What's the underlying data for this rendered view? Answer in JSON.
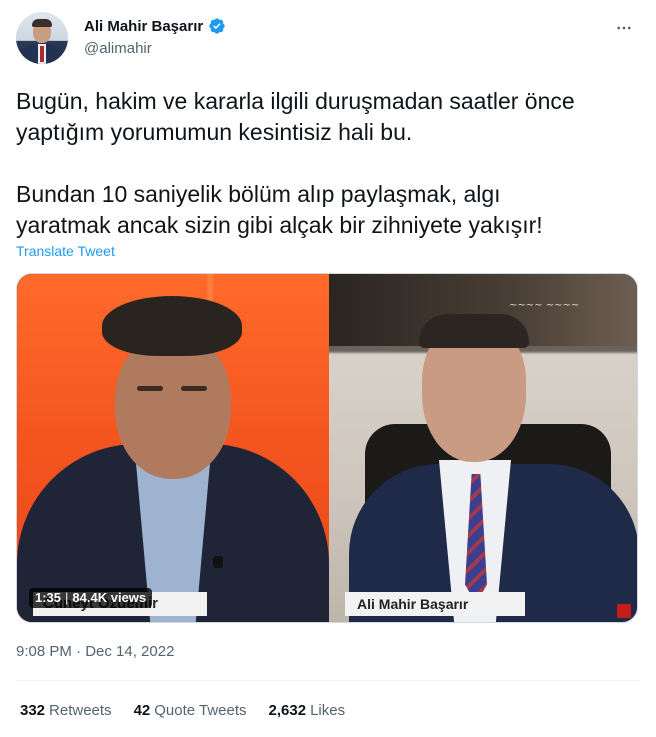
{
  "author": {
    "display_name": "Ali Mahir Başarır",
    "handle": "@alimahir",
    "verified": true,
    "avatar_icon": "profile-photo"
  },
  "more_icon": "more-horizontal-icon",
  "tweet": {
    "text": "Bugün, hakim ve kararla ilgili duruşmadan saatler önce\nyaptığım yorumumun kesintisiz hali bu.\n\nBundan 10 saniyelik bölüm alıp paylaşmak, algı\nyaratmak ancak sizin gibi alçak bir zihniyete yakışır!",
    "translate_label": "Translate Tweet"
  },
  "media": {
    "duration": "1:35",
    "views": "84.4K views",
    "left_caption": "Cüneyt Özdemir",
    "right_caption": "Ali Mahir Başarır"
  },
  "meta": {
    "timestamp": "9:08 PM · Dec 14, 2022"
  },
  "stats": {
    "retweets_count": "332",
    "retweets_label": "Retweets",
    "quotes_count": "42",
    "quotes_label": "Quote Tweets",
    "likes_count": "2,632",
    "likes_label": "Likes"
  },
  "colors": {
    "link": "#1d9bf0",
    "secondary_text": "#536471",
    "primary_text": "#0f1419"
  }
}
